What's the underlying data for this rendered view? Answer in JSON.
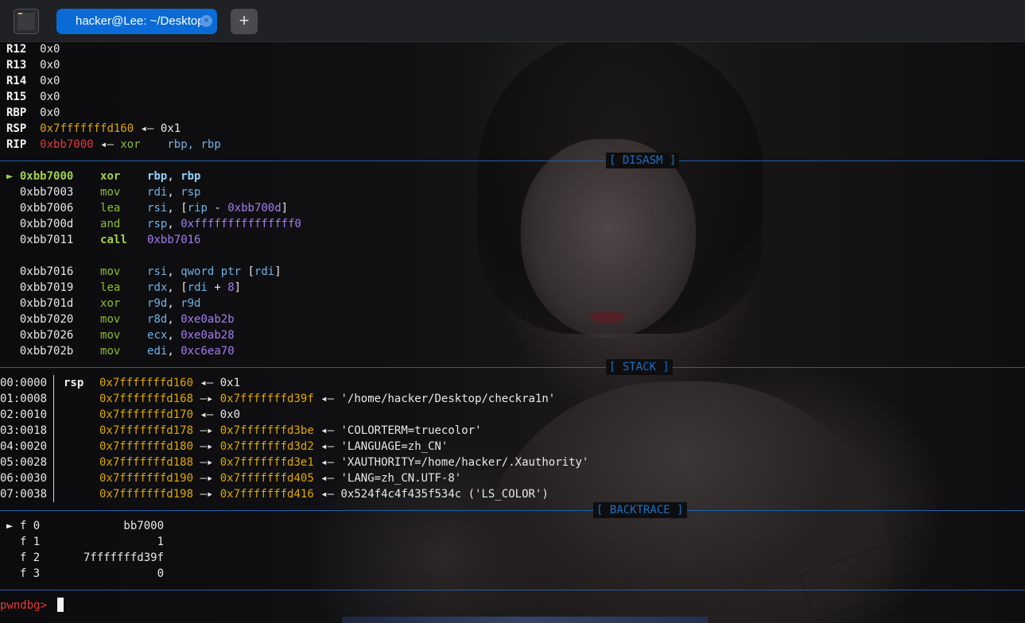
{
  "window": {
    "tab_title": "hacker@Lee: ~/Desktop",
    "tab_close": "×",
    "new_tab": "+"
  },
  "registers": [
    {
      "name": "R12",
      "value": "0x0"
    },
    {
      "name": "R13",
      "value": "0x0"
    },
    {
      "name": "R14",
      "value": "0x0"
    },
    {
      "name": "R15",
      "value": "0x0"
    },
    {
      "name": "RBP",
      "value": "0x0"
    },
    {
      "name": "RSP",
      "value": "0x7fffffffd160",
      "arrow": "◂— ",
      "rest": "0x1"
    },
    {
      "name": "RIP",
      "value": "0xbb7000",
      "arrow": "◂— ",
      "op": "xor",
      "args": "rbp, rbp"
    }
  ],
  "sections": {
    "disasm": "[ DISASM ]",
    "stack": "[ STACK ]",
    "backtrace": "[ BACKTRACE ]"
  },
  "disasm": [
    {
      "marker": "►",
      "addr": "0xbb7000",
      "op": "xor",
      "a1": "rbp",
      "sep": ", ",
      "a2": "rbp",
      "current": true
    },
    {
      "marker": "",
      "addr": "0xbb7003",
      "op": "mov",
      "a1": "rdi",
      "sep": ", ",
      "a2": "rsp"
    },
    {
      "marker": "",
      "addr": "0xbb7006",
      "op": "lea",
      "a1": "rsi",
      "sep": ", [",
      "a2": "rip",
      "tail": " - ",
      "num": "0xbb700d",
      "end": "]"
    },
    {
      "marker": "",
      "addr": "0xbb700d",
      "op": "and",
      "a1": "rsp",
      "sep": ", ",
      "num": "0xfffffffffffffff0"
    },
    {
      "marker": "",
      "addr": "0xbb7011",
      "op": "call",
      "num": "0xbb7016",
      "call": true
    },
    {
      "marker": "",
      "addr": "0xbb7016",
      "op": "mov",
      "a1": "rsi",
      "sep": ", ",
      "kw": "qword ptr",
      "open": " [",
      "a2": "rdi",
      "end": "]"
    },
    {
      "marker": "",
      "addr": "0xbb7019",
      "op": "lea",
      "a1": "rdx",
      "sep": ", [",
      "a2": "rdi",
      "tail": " + ",
      "num": "8",
      "end": "]"
    },
    {
      "marker": "",
      "addr": "0xbb701d",
      "op": "xor",
      "a1": "r9d",
      "sep": ", ",
      "a2": "r9d"
    },
    {
      "marker": "",
      "addr": "0xbb7020",
      "op": "mov",
      "a1": "r8d",
      "sep": ", ",
      "num": "0xe0ab2b"
    },
    {
      "marker": "",
      "addr": "0xbb7026",
      "op": "mov",
      "a1": "ecx",
      "sep": ", ",
      "num": "0xe0ab28"
    },
    {
      "marker": "",
      "addr": "0xbb702b",
      "op": "mov",
      "a1": "edi",
      "sep": ", ",
      "num": "0xc6ea70"
    }
  ],
  "stack": [
    {
      "off": "00:0000",
      "reg": "rsp",
      "addr": "0x7fffffffd160",
      "arrow": "◂— ",
      "val": "0x1"
    },
    {
      "off": "01:0008",
      "addr": "0x7fffffffd168",
      "arrow": "—▸ ",
      "ptr": "0x7fffffffd39f",
      "arrow2": "◂— ",
      "val": "'/home/hacker/Desktop/checkra1n'"
    },
    {
      "off": "02:0010",
      "addr": "0x7fffffffd170",
      "arrow": "◂— ",
      "val": "0x0"
    },
    {
      "off": "03:0018",
      "addr": "0x7fffffffd178",
      "arrow": "—▸ ",
      "ptr": "0x7fffffffd3be",
      "arrow2": "◂— ",
      "val": "'COLORTERM=truecolor'"
    },
    {
      "off": "04:0020",
      "addr": "0x7fffffffd180",
      "arrow": "—▸ ",
      "ptr": "0x7fffffffd3d2",
      "arrow2": "◂— ",
      "val": "'LANGUAGE=zh_CN'"
    },
    {
      "off": "05:0028",
      "addr": "0x7fffffffd188",
      "arrow": "—▸ ",
      "ptr": "0x7fffffffd3e1",
      "arrow2": "◂— ",
      "val": "'XAUTHORITY=/home/hacker/.Xauthority'"
    },
    {
      "off": "06:0030",
      "addr": "0x7fffffffd190",
      "arrow": "—▸ ",
      "ptr": "0x7fffffffd405",
      "arrow2": "◂— ",
      "val": "'LANG=zh_CN.UTF-8'"
    },
    {
      "off": "07:0038",
      "addr": "0x7fffffffd198",
      "arrow": "—▸ ",
      "ptr": "0x7fffffffd416",
      "arrow2": "◂— ",
      "val": "0x524f4c4f435f534c ('LS_COLOR')"
    }
  ],
  "backtrace": [
    {
      "marker": "►",
      "frame": "f 0",
      "addr": "bb7000"
    },
    {
      "marker": "",
      "frame": "f 1",
      "addr": "1"
    },
    {
      "marker": "",
      "frame": "f 2",
      "addr": "7fffffffd39f"
    },
    {
      "marker": "",
      "frame": "f 3",
      "addr": "0"
    }
  ],
  "prompt": "pwndbg> "
}
